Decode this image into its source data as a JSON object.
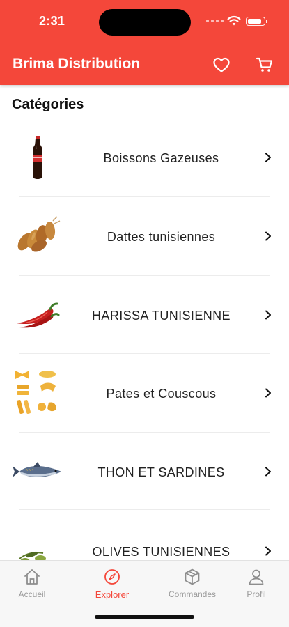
{
  "status_bar": {
    "time": "2:31"
  },
  "app_bar": {
    "title": "Brima Distribution"
  },
  "section": {
    "title": "Catégories"
  },
  "categories": [
    {
      "label": "Boissons Gazeuses"
    },
    {
      "label": "Dattes tunisiennes"
    },
    {
      "label": "HARISSA TUNISIENNE"
    },
    {
      "label": "Pates et Couscous"
    },
    {
      "label": "THON ET SARDINES"
    },
    {
      "label": "OLIVES TUNISIENNES"
    }
  ],
  "tabs": [
    {
      "label": "Accueil",
      "icon": "home-icon"
    },
    {
      "label": "Explorer",
      "icon": "compass-icon",
      "active": true
    },
    {
      "label": "Commandes",
      "icon": "box-icon"
    },
    {
      "label": "Profil",
      "icon": "person-icon"
    }
  ],
  "colors": {
    "accent": "#f4473a",
    "tab_inactive": "#9a9a9a"
  }
}
